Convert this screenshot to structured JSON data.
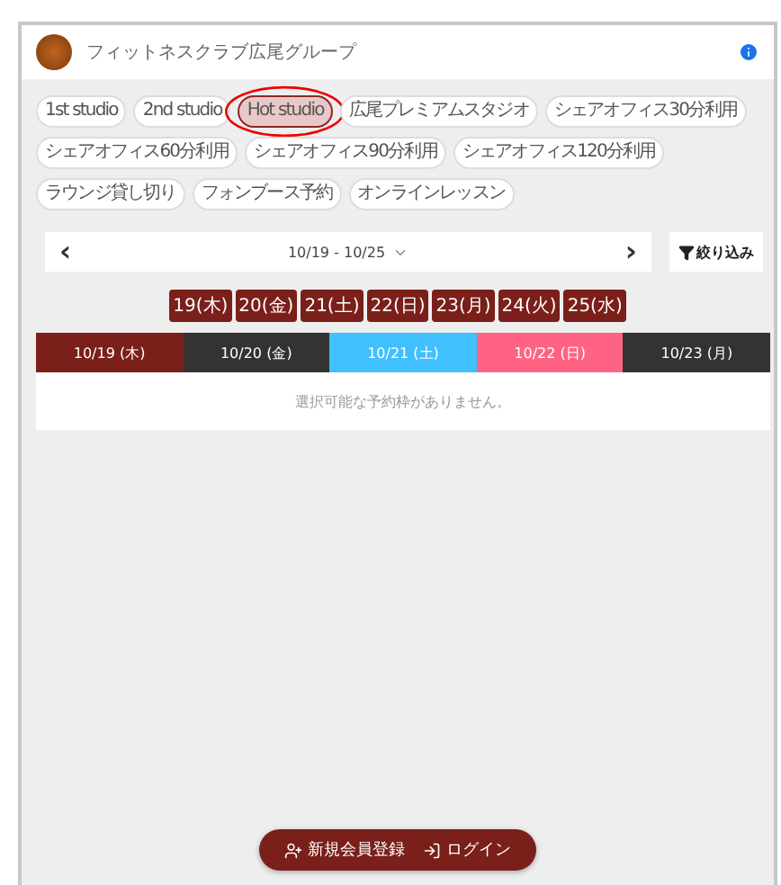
{
  "header": {
    "title": "フィットネスクラブ広尾グループ"
  },
  "studios": [
    {
      "label": "1st studio",
      "selected": false
    },
    {
      "label": "2nd studio",
      "selected": false
    },
    {
      "label": "Hot studio",
      "selected": true
    },
    {
      "label": "広尾プレミアムスタジオ",
      "selected": false
    },
    {
      "label": "シェアオフィス30分利用",
      "selected": false
    },
    {
      "label": "シェアオフィス60分利用",
      "selected": false
    },
    {
      "label": "シェアオフィス90分利用",
      "selected": false
    },
    {
      "label": "シェアオフィス120分利用",
      "selected": false
    },
    {
      "label": "ラウンジ貸し切り",
      "selected": false
    },
    {
      "label": "フォンブース予約",
      "selected": false
    },
    {
      "label": "オンラインレッスン",
      "selected": false
    }
  ],
  "week_nav": {
    "prev": "‹",
    "range": "10/19 - 10/25",
    "next": "›",
    "filter": "絞り込み"
  },
  "day_buttons": [
    "19(木)",
    "20(金)",
    "21(土)",
    "22(日)",
    "23(月)",
    "24(火)",
    "25(水)"
  ],
  "day_tabs": [
    {
      "label": "10/19 (木)",
      "kind": "weekday",
      "selected": true
    },
    {
      "label": "10/20 (金)",
      "kind": "weekday",
      "selected": false
    },
    {
      "label": "10/21 (土)",
      "kind": "saturday",
      "selected": false
    },
    {
      "label": "10/22 (日)",
      "kind": "sunday",
      "selected": false
    },
    {
      "label": "10/23 (月)",
      "kind": "weekday",
      "selected": false
    }
  ],
  "empty_message": "選択可能な予約枠がありません。",
  "footer": {
    "register": "新規会員登録",
    "login": "ログイン"
  }
}
